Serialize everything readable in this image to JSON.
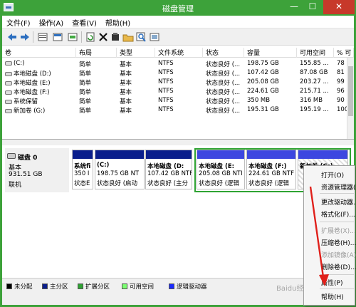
{
  "window": {
    "title": "磁盘管理",
    "min": "—",
    "max": "☐",
    "close": "✕"
  },
  "menu": [
    "文件(F)",
    "操作(A)",
    "查看(V)",
    "帮助(H)"
  ],
  "toolbar_icons": [
    "back-icon",
    "forward-icon",
    "properties-icon",
    "help-pane-icon",
    "refresh-icon",
    "delete-icon",
    "new-icon",
    "open-folder-icon",
    "rescan-icon",
    "list-icon"
  ],
  "volume_table": {
    "headers": [
      "卷",
      "布局",
      "类型",
      "文件系统",
      "状态",
      "容量",
      "可用空间",
      "% 可"
    ],
    "rows": [
      [
        "(C:)",
        "简单",
        "基本",
        "NTFS",
        "状态良好 (...",
        "198.75 GB",
        "155.85 ...",
        "78 %"
      ],
      [
        "本地磁盘 (D:)",
        "简单",
        "基本",
        "NTFS",
        "状态良好 (...",
        "107.42 GB",
        "87.08 GB",
        "81 %"
      ],
      [
        "本地磁盘 (E:)",
        "简单",
        "基本",
        "NTFS",
        "状态良好 (...",
        "205.08 GB",
        "203.27 ...",
        "99 %"
      ],
      [
        "本地磁盘 (F:)",
        "简单",
        "基本",
        "NTFS",
        "状态良好 (...",
        "224.61 GB",
        "215.71 ...",
        "96 %"
      ],
      [
        "系统保留",
        "简单",
        "基本",
        "NTFS",
        "状态良好 (...",
        "350 MB",
        "316 MB",
        "90 %"
      ],
      [
        "新加卷 (G:)",
        "简单",
        "基本",
        "NTFS",
        "状态良好 (...",
        "195.31 GB",
        "195.19 ...",
        "100 %"
      ]
    ]
  },
  "disk": {
    "name": "磁盘 0",
    "type": "基本",
    "size": "931.51 GB",
    "status": "联机"
  },
  "partitions": [
    {
      "line1": "系统fi",
      "line2": "350 I",
      "line3": "状态E"
    },
    {
      "line1": "(C:)",
      "line2": "198.75 GB NT",
      "line3": "状态良好 (启动"
    },
    {
      "line1": "本地磁盘 (D:",
      "line2": "107.42 GB NTF",
      "line3": "状态良好 (主分"
    },
    {
      "line1": "本地磁盘 (E:",
      "line2": "205.08 GB NTI",
      "line3": "状态良好 (逻辑"
    },
    {
      "line1": "本地磁盘 (F:)",
      "line2": "224.61 GB NTF",
      "line3": "状态良好 (逻辑"
    },
    {
      "line1": "新加卷 (G:)",
      "line2": "",
      "line3": ""
    }
  ],
  "legend": [
    "未分配",
    "主分区",
    "扩展分区",
    "可用空间",
    "逻辑驱动器"
  ],
  "legend_colors": [
    "#000000",
    "#0a1e8c",
    "#2fa333",
    "#7cff72",
    "#1a2bff"
  ],
  "context_menu": {
    "items": [
      {
        "label": "打开(O)",
        "enabled": true
      },
      {
        "label": "资源管理器(E)",
        "enabled": true
      },
      {
        "label": "更改驱动器...",
        "enabled": true
      },
      {
        "label": "格式化(F)...",
        "enabled": true
      },
      {
        "label": "扩展卷(X)...",
        "enabled": false
      },
      {
        "label": "压缩卷(H)...",
        "enabled": true
      },
      {
        "label": "添加镜像(A)...",
        "enabled": false
      },
      {
        "label": "删除卷(D)...",
        "enabled": true
      },
      {
        "label": "属性(P)",
        "enabled": true
      },
      {
        "label": "帮助(H)",
        "enabled": true
      }
    ]
  },
  "watermark": "Baidu经验",
  "colors": {
    "title_bar": "#3da23a",
    "arrow": "#e0201b"
  }
}
